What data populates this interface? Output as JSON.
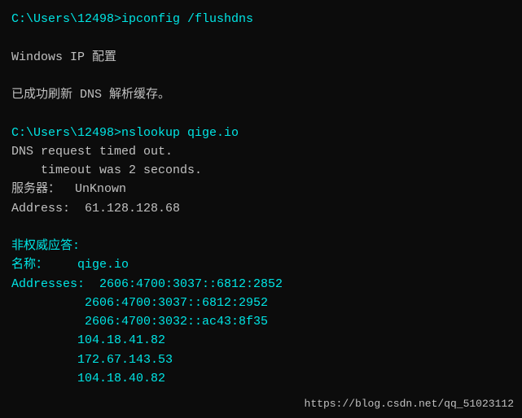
{
  "terminal": {
    "lines": [
      {
        "type": "cyan",
        "text": "C:\\Users\\12498>ipconfig /flushdns"
      },
      {
        "type": "empty"
      },
      {
        "type": "white",
        "text": "Windows IP 配置"
      },
      {
        "type": "empty"
      },
      {
        "type": "white",
        "text": "已成功刷新 DNS 解析缓存。"
      },
      {
        "type": "empty"
      },
      {
        "type": "cyan",
        "text": "C:\\Users\\12498>nslookup qige.io"
      },
      {
        "type": "white",
        "text": "DNS request timed out."
      },
      {
        "type": "white",
        "text": "    timeout was 2 seconds."
      },
      {
        "type": "white",
        "text": "服务器：  UnKnown"
      },
      {
        "type": "white",
        "text": "Address:  61.128.128.68"
      },
      {
        "type": "empty"
      },
      {
        "type": "cyan",
        "text": "非权威应答:"
      },
      {
        "type": "cyan",
        "text": "名称：    qige.io"
      },
      {
        "type": "cyan",
        "text": "Addresses:  2606:4700:3037::6812:2852"
      },
      {
        "type": "cyan",
        "text": "          2606:4700:3037::6812:2952"
      },
      {
        "type": "cyan",
        "text": "          2606:4700:3032::ac43:8f35"
      },
      {
        "type": "cyan",
        "text": "         104.18.41.82"
      },
      {
        "type": "cyan",
        "text": "         172.67.143.53"
      },
      {
        "type": "cyan",
        "text": "         104.18.40.82"
      }
    ],
    "watermark": "https://blog.csdn.net/qq_51023112"
  }
}
